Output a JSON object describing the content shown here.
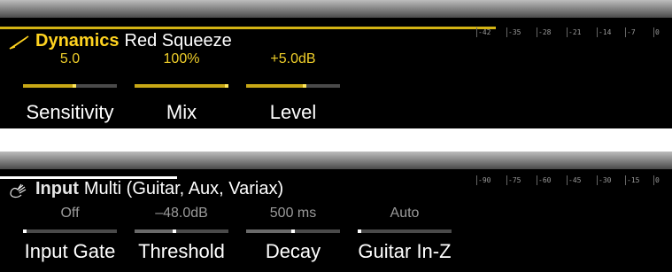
{
  "blocks": [
    {
      "id": "dynamics",
      "category": "Dynamics",
      "model": "Red Squeeze",
      "icon": "compressor-icon",
      "accent": "#ffd320",
      "params": [
        {
          "value": "5.0",
          "label": "Sensitivity",
          "level": 0.55
        },
        {
          "value": "100%",
          "label": "Mix",
          "level": 1.0
        },
        {
          "value": "+5.0dB",
          "label": "Level",
          "level": 0.62
        }
      ],
      "meter_ticks": [
        "-42",
        "-35",
        "-28",
        "-21",
        "-14",
        "-7",
        "0"
      ]
    },
    {
      "id": "input",
      "category": "Input",
      "model": "Multi (Guitar, Aux, Variax)",
      "icon": "guitar-hand-icon",
      "accent": "#e6e6e6",
      "params": [
        {
          "value": "Off",
          "label": "Input Gate",
          "level": 0.0
        },
        {
          "value": "–48.0dB",
          "label": "Threshold",
          "level": 0.42
        },
        {
          "value": "500 ms",
          "label": "Decay",
          "level": 0.5
        },
        {
          "value": "Auto",
          "label": "Guitar In-Z",
          "level": 0.0
        }
      ],
      "meter_ticks": [
        "-90",
        "-75",
        "-60",
        "-45",
        "-30",
        "-15",
        "0"
      ]
    }
  ]
}
